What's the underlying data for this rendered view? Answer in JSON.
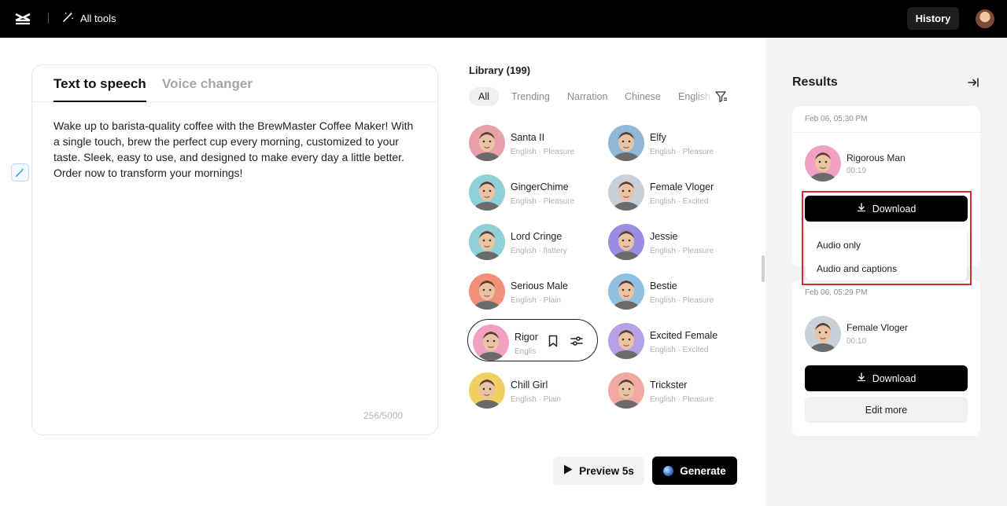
{
  "topbar": {
    "all_tools_label": "All tools",
    "history_label": "History"
  },
  "editor": {
    "tabs": [
      {
        "label": "Text to speech",
        "active": true
      },
      {
        "label": "Voice changer",
        "active": false
      }
    ],
    "text": "Wake up to barista-quality coffee with the BrewMaster Coffee Maker! With a single touch, brew the perfect cup every morning, customized to your taste. Sleek, easy to use, and designed to make every day a little better. Order now to transform your mornings!",
    "char_count": "256/5000"
  },
  "library": {
    "title": "Library (199)",
    "filters": [
      "All",
      "Trending",
      "Narration",
      "Chinese",
      "English"
    ],
    "active_filter": "All",
    "voices": [
      {
        "name": "Santa II",
        "sub": "English · Pleasure",
        "color": "#e8a0a8"
      },
      {
        "name": "Elfy",
        "sub": "English · Pleasure",
        "color": "#8fb8d8"
      },
      {
        "name": "GingerChime",
        "sub": "English · Pleasure",
        "color": "#8fd0d8"
      },
      {
        "name": "Female Vloger",
        "sub": "English · Excited",
        "color": "#c8d0d8"
      },
      {
        "name": "Lord Cringe",
        "sub": "English · flattery",
        "color": "#8fd0d8"
      },
      {
        "name": "Jessie",
        "sub": "English · Pleasure",
        "color": "#9a8ce0"
      },
      {
        "name": "Serious Male",
        "sub": "English · Plain",
        "color": "#f0907a"
      },
      {
        "name": "Bestie",
        "sub": "English · Pleasure",
        "color": "#8fc0e0"
      },
      {
        "name": "Rigorous Man",
        "sub": "English · Plain",
        "color": "#f0a0c0",
        "selected": true
      },
      {
        "name": "Excited Female",
        "sub": "English · Excited",
        "color": "#b8a0e8"
      },
      {
        "name": "Chill Girl",
        "sub": "English · Plain",
        "color": "#f0d060"
      },
      {
        "name": "Trickster",
        "sub": "English · Pleasure",
        "color": "#f0a8a0"
      }
    ]
  },
  "actions": {
    "preview_label": "Preview 5s",
    "generate_label": "Generate"
  },
  "results": {
    "title": "Results",
    "items": [
      {
        "date": "Feb 06, 05:30 PM",
        "voice": "Rigorous Man",
        "duration": "00:19",
        "download_label": "Download",
        "color": "#f0a0c0"
      },
      {
        "date": "Feb 06, 05:29 PM",
        "voice": "Female Vloger",
        "duration": "00:10",
        "download_label": "Download",
        "edit_label": "Edit more",
        "color": "#c8d0d8"
      }
    ],
    "download_menu": [
      "Audio only",
      "Audio and captions"
    ]
  },
  "colors": {
    "accent": "#000000",
    "highlight": "#e0262e",
    "results_bg": "#f2f3f5"
  }
}
